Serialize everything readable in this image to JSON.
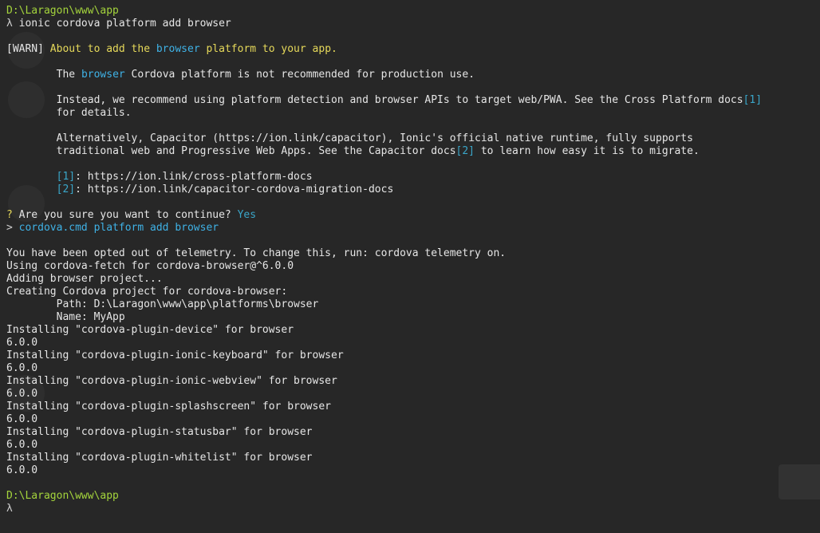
{
  "colors": {
    "background": "#272727",
    "path": "#a4d43c",
    "warn": "#e6d95a",
    "highlight": "#3fb2e6",
    "text": "#e6e6e6"
  },
  "terminal": {
    "prompt_path_1": "D:\\Laragon\\www\\app",
    "lambda": "λ",
    "command_1": " ionic cordova platform add browser",
    "warn": {
      "tag": "[WARN]",
      "text_a": " About to add the ",
      "browser": "browser",
      "text_b": " platform to your app."
    },
    "para1": {
      "a": "The ",
      "browser": "browser",
      "b": " Cordova platform is not recommended for production use."
    },
    "para2": {
      "line1a": "Instead, we recommend using platform detection and browser APIs to target web/PWA. See the Cross Platform docs",
      "ref1": "[1]",
      "line2": "for details."
    },
    "para3": {
      "line1a": "Alternatively, ",
      "capacitor": "Capacitor",
      "line1b": " (https://ion.link/capacitor), Ionic's official native runtime, fully supports",
      "line2a": "traditional web and Progressive Web Apps. See the Capacitor docs",
      "ref2": "[2]",
      "line2b": " to learn how easy it is to migrate."
    },
    "links": [
      {
        "ref": "[1]",
        "url": ": https://ion.link/cross-platform-docs"
      },
      {
        "ref": "[2]",
        "url": ": https://ion.link/capacitor-cordova-migration-docs"
      }
    ],
    "question": {
      "mark": "?",
      "text": " Are you sure you want to continue? ",
      "answer": "Yes"
    },
    "run": {
      "arrow": ">",
      "cmd": " cordova.cmd platform add browser"
    },
    "output": [
      "You have been opted out of telemetry. To change this, run: cordova telemetry on.",
      "Using cordova-fetch for cordova-browser@^6.0.0",
      "Adding browser project...",
      "Creating Cordova project for cordova-browser:",
      "        Path: D:\\Laragon\\www\\app\\platforms\\browser",
      "        Name: MyApp",
      "Installing \"cordova-plugin-device\" for browser",
      "6.0.0",
      "Installing \"cordova-plugin-ionic-keyboard\" for browser",
      "6.0.0",
      "Installing \"cordova-plugin-ionic-webview\" for browser",
      "6.0.0",
      "Installing \"cordova-plugin-splashscreen\" for browser",
      "6.0.0",
      "Installing \"cordova-plugin-statusbar\" for browser",
      "6.0.0",
      "Installing \"cordova-plugin-whitelist\" for browser",
      "6.0.0"
    ],
    "prompt_path_2": "D:\\Laragon\\www\\app",
    "lambda_2": "λ"
  }
}
